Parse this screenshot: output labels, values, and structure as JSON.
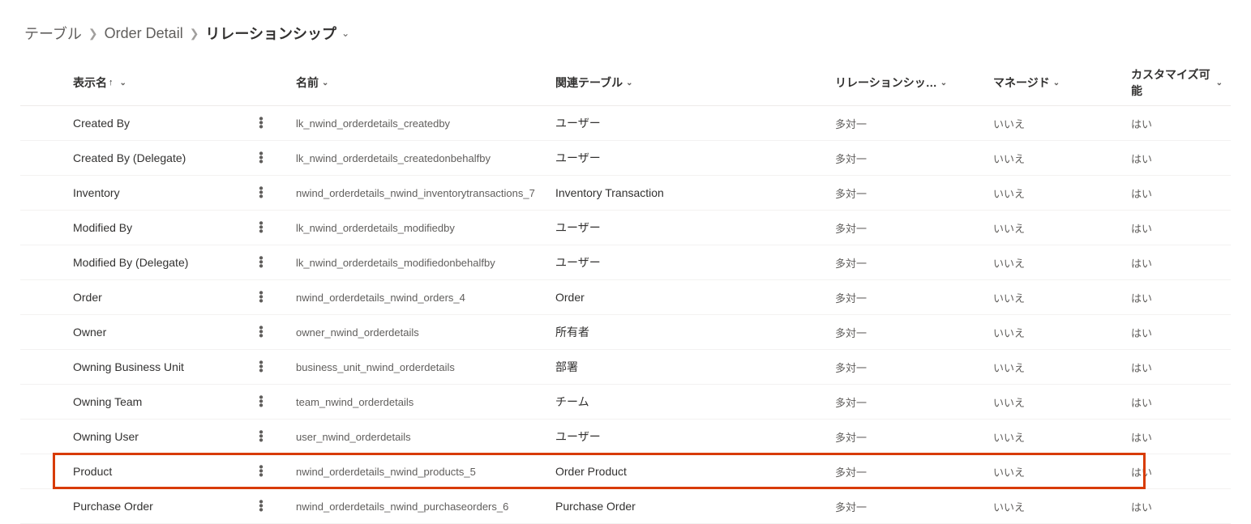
{
  "breadcrumb": {
    "root": "テーブル",
    "mid": "Order Detail",
    "current": "リレーションシップ"
  },
  "headers": {
    "display": "表示名",
    "name": "名前",
    "related": "関連テーブル",
    "reltype": "リレーションシッ…",
    "managed": "マネージド",
    "custom": "カスタマイズ可能"
  },
  "rows": [
    {
      "display": "Created By",
      "name": "lk_nwind_orderdetails_createdby",
      "related": "ユーザー",
      "reltype": "多対一",
      "managed": "いいえ",
      "custom": "はい",
      "hl": false
    },
    {
      "display": "Created By (Delegate)",
      "name": "lk_nwind_orderdetails_createdonbehalfby",
      "related": "ユーザー",
      "reltype": "多対一",
      "managed": "いいえ",
      "custom": "はい",
      "hl": false
    },
    {
      "display": "Inventory",
      "name": "nwind_orderdetails_nwind_inventorytransactions_7",
      "related": "Inventory Transaction",
      "reltype": "多対一",
      "managed": "いいえ",
      "custom": "はい",
      "hl": false
    },
    {
      "display": "Modified By",
      "name": "lk_nwind_orderdetails_modifiedby",
      "related": "ユーザー",
      "reltype": "多対一",
      "managed": "いいえ",
      "custom": "はい",
      "hl": false
    },
    {
      "display": "Modified By (Delegate)",
      "name": "lk_nwind_orderdetails_modifiedonbehalfby",
      "related": "ユーザー",
      "reltype": "多対一",
      "managed": "いいえ",
      "custom": "はい",
      "hl": false
    },
    {
      "display": "Order",
      "name": "nwind_orderdetails_nwind_orders_4",
      "related": "Order",
      "reltype": "多対一",
      "managed": "いいえ",
      "custom": "はい",
      "hl": false
    },
    {
      "display": "Owner",
      "name": "owner_nwind_orderdetails",
      "related": "所有者",
      "reltype": "多対一",
      "managed": "いいえ",
      "custom": "はい",
      "hl": false
    },
    {
      "display": "Owning Business Unit",
      "name": "business_unit_nwind_orderdetails",
      "related": "部署",
      "reltype": "多対一",
      "managed": "いいえ",
      "custom": "はい",
      "hl": false
    },
    {
      "display": "Owning Team",
      "name": "team_nwind_orderdetails",
      "related": "チーム",
      "reltype": "多対一",
      "managed": "いいえ",
      "custom": "はい",
      "hl": false
    },
    {
      "display": "Owning User",
      "name": "user_nwind_orderdetails",
      "related": "ユーザー",
      "reltype": "多対一",
      "managed": "いいえ",
      "custom": "はい",
      "hl": false
    },
    {
      "display": "Product",
      "name": "nwind_orderdetails_nwind_products_5",
      "related": "Order Product",
      "reltype": "多対一",
      "managed": "いいえ",
      "custom": "はい",
      "hl": true
    },
    {
      "display": "Purchase Order",
      "name": "nwind_orderdetails_nwind_purchaseorders_6",
      "related": "Purchase Order",
      "reltype": "多対一",
      "managed": "いいえ",
      "custom": "はい",
      "hl": false
    }
  ]
}
